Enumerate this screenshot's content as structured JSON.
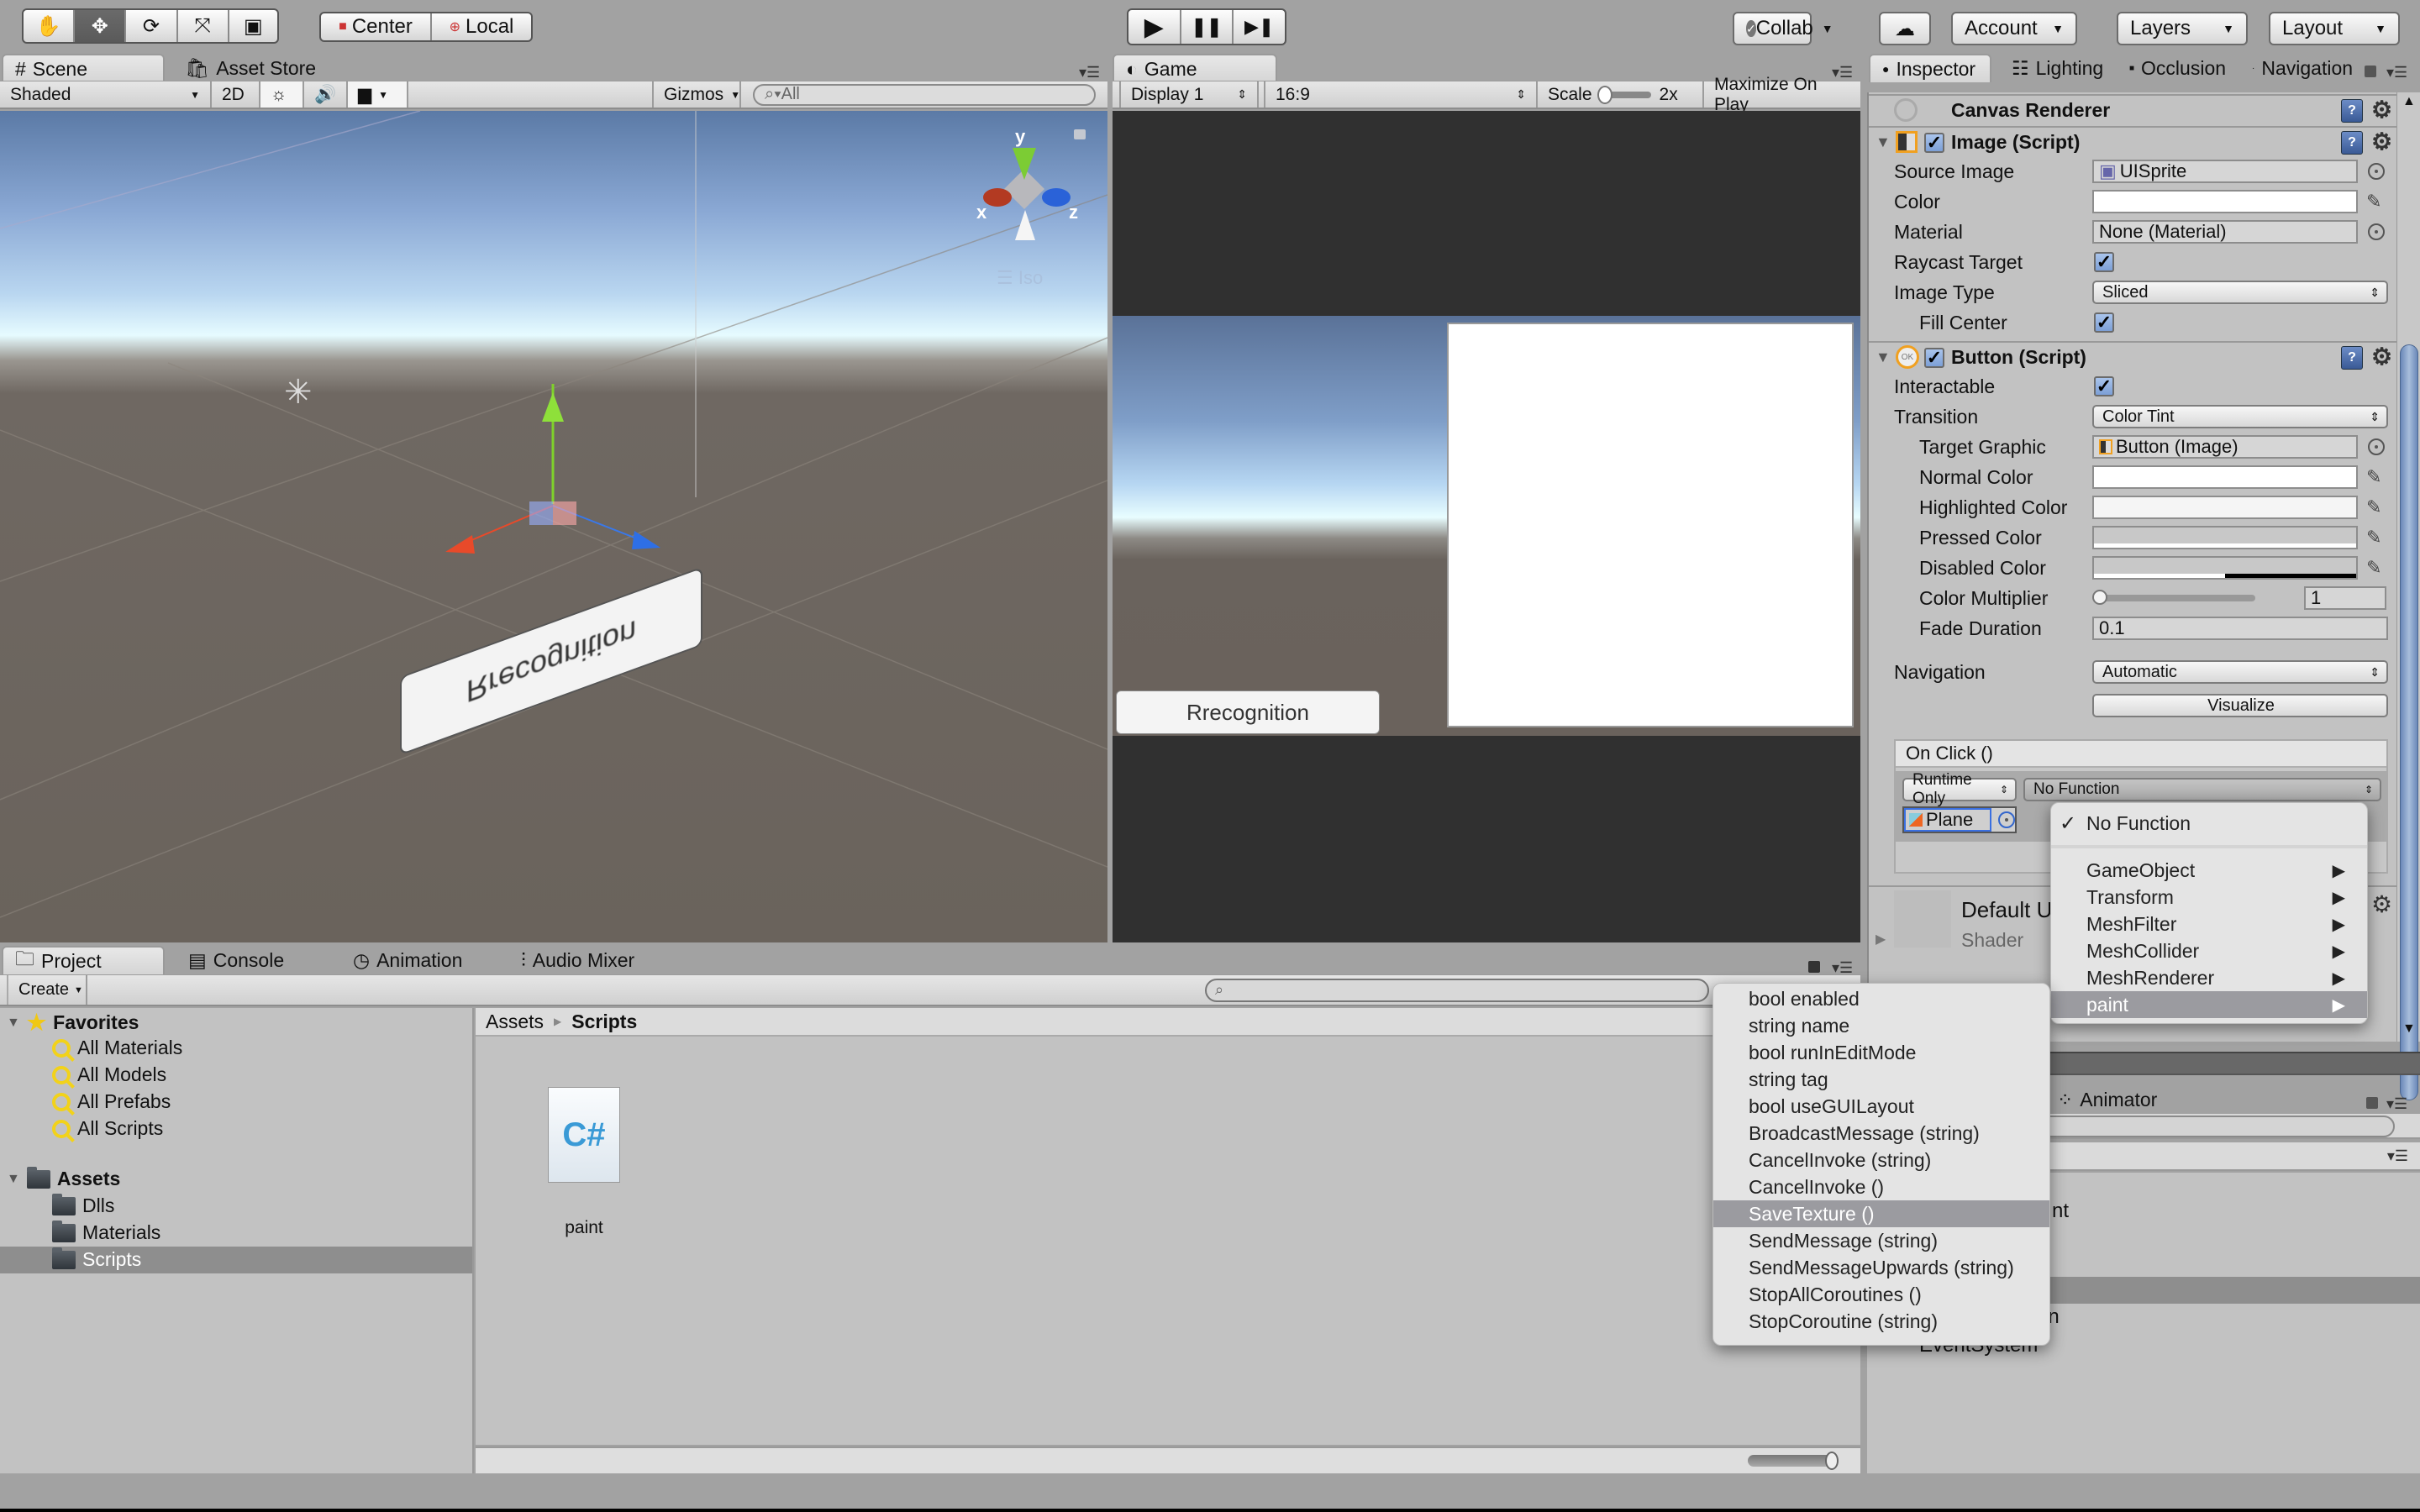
{
  "toolbar": {
    "tools": [
      {
        "icon": "hand-icon",
        "glyph": "✋",
        "active": false
      },
      {
        "icon": "move-icon",
        "glyph": "✥",
        "active": true
      },
      {
        "icon": "rotate-icon",
        "glyph": "⟳",
        "active": false
      },
      {
        "icon": "scale-icon",
        "glyph": "⤧",
        "active": false
      },
      {
        "icon": "rect-tool-icon",
        "glyph": "▣",
        "active": false
      }
    ],
    "pivot": [
      "Center",
      "Local"
    ],
    "play": {
      "play": "▶",
      "pause": "❚❚",
      "step": "▶❚"
    },
    "collab": "Collab",
    "cloud": "☁",
    "account": "Account",
    "layers": "Layers",
    "layout": "Layout"
  },
  "scene": {
    "tabs": [
      "Scene",
      "Asset Store"
    ],
    "shading": "Shaded",
    "mode2d": "2D",
    "gizmos": "Gizmos",
    "search_placeholder": "All",
    "axis_labels": {
      "x": "x",
      "y": "y",
      "z": "z"
    },
    "view_label": "Iso",
    "button_text": "Rrecognition"
  },
  "game": {
    "tab": "Game",
    "display": "Display 1",
    "aspect": "16:9",
    "scale_label": "Scale",
    "scale_value": "2x",
    "maximize": "Maximize On Play",
    "button_text": "Rrecognition"
  },
  "inspector": {
    "tabs": [
      "Inspector",
      "Lighting",
      "Occlusion",
      "Navigation"
    ],
    "canvas_renderer": "Canvas Renderer",
    "image": {
      "title": "Image (Script)",
      "enabled": true,
      "fields": {
        "source_image_label": "Source Image",
        "source_image": "UISprite",
        "color_label": "Color",
        "color": "#ffffff",
        "material_label": "Material",
        "material": "None (Material)",
        "raycast_label": "Raycast Target",
        "raycast": true,
        "image_type_label": "Image Type",
        "image_type": "Sliced",
        "fill_center_label": "Fill Center",
        "fill_center": true
      }
    },
    "button": {
      "title": "Button (Script)",
      "enabled": true,
      "interactable_label": "Interactable",
      "interactable": true,
      "transition_label": "Transition",
      "transition": "Color Tint",
      "target_graphic_label": "Target Graphic",
      "target_graphic": "Button (Image)",
      "normal_color_label": "Normal Color",
      "highlighted_color_label": "Highlighted Color",
      "pressed_color_label": "Pressed Color",
      "disabled_color_label": "Disabled Color",
      "color_multiplier_label": "Color Multiplier",
      "color_multiplier": "1",
      "fade_duration_label": "Fade Duration",
      "fade_duration": "0.1",
      "navigation_label": "Navigation",
      "navigation": "Automatic",
      "visualize": "Visualize"
    },
    "onclick": {
      "title": "On Click ()",
      "runtime": "Runtime Only",
      "function": "No Function",
      "object": "Plane"
    },
    "material": {
      "title": "Default U",
      "shader_label": "Shader"
    }
  },
  "function_menu": {
    "checked": "No Function",
    "items": [
      "GameObject",
      "Transform",
      "MeshFilter",
      "MeshCollider",
      "MeshRenderer",
      "paint"
    ],
    "highlighted": "paint"
  },
  "paint_submenu": {
    "items": [
      "bool enabled",
      "string name",
      "bool runInEditMode",
      "string tag",
      "bool useGUILayout",
      "BroadcastMessage (string)",
      "CancelInvoke (string)",
      "CancelInvoke ()",
      "SaveTexture ()",
      "SendMessage (string)",
      "SendMessageUpwards (string)",
      "StopAllCoroutines ()",
      "StopCoroutine (string)"
    ],
    "highlighted": "SaveTexture ()"
  },
  "project": {
    "tabs": [
      "Project",
      "Console",
      "Animation",
      "Audio Mixer"
    ],
    "create": "Create",
    "favorites": {
      "label": "Favorites",
      "items": [
        "All Materials",
        "All Models",
        "All Prefabs",
        "All Scripts"
      ]
    },
    "assets": {
      "label": "Assets",
      "items": [
        "Dlls",
        "Materials",
        "Scripts"
      ],
      "selected": "Scripts"
    },
    "breadcrumb": [
      "Assets",
      "Scripts"
    ],
    "files": [
      {
        "name": "paint",
        "type": "C#"
      }
    ]
  },
  "hierarchy": {
    "tab": "Animator",
    "partial_rows": [
      "nt",
      "tion",
      "EventSystem"
    ]
  }
}
